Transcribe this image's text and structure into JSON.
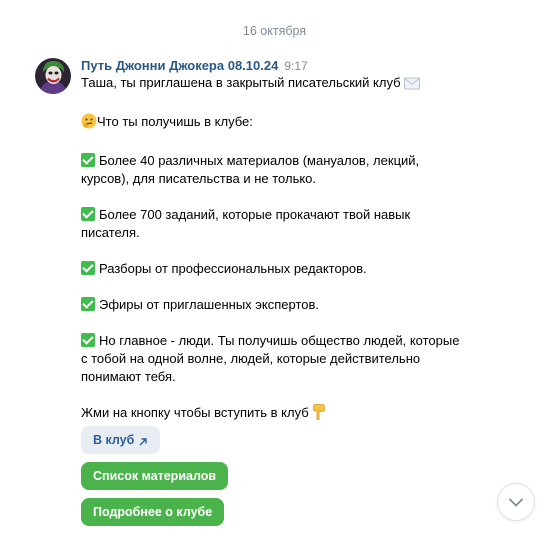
{
  "date_separator": "16 октября",
  "message": {
    "sender": "Путь Джонни Джокера 08.10.24",
    "time": "9:17",
    "lines": {
      "invite": "Таша, ты приглашена в закрытый писательский клуб",
      "what_you_get": "Что ты получишь в клубе:",
      "item1_a": "Более 40 различных материалов (мануалов, лекций,",
      "item1_b": "курсов), для писательства и не только.",
      "item2_a": "Более 700 заданий, которые прокачают твой навык",
      "item2_b": "писателя.",
      "item3": "Разборы от профессиональных редакторов.",
      "item4": "Эфиры от приглашенных экспертов.",
      "item5_a": "Но главное - люди. Ты получишь общество людей, которые",
      "item5_b": "с тобой на одной волне, людей, которые действительно",
      "item5_c": "понимают тебя.",
      "cta": "Жми на кнопку чтобы вступить в клуб"
    },
    "icons": {
      "envelope": "envelope-icon",
      "thinking_face": "thinking-face-icon",
      "check": "check-mark-button-icon",
      "pointing_down": "backhand-index-pointing-down-icon"
    }
  },
  "buttons": {
    "join": "В клуб",
    "materials": "Список материалов",
    "more": "Подробнее о клубе"
  },
  "colors": {
    "sender": "#2a5885",
    "muted": "#818c99",
    "green_button": "#4bb34b",
    "secondary_button": "#e8edf3",
    "check": "#3ebd4c"
  }
}
